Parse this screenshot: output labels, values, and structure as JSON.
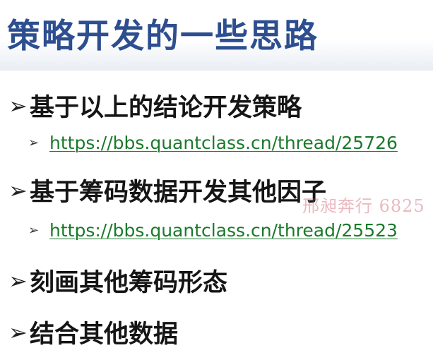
{
  "slide": {
    "title": "策略开发的一些思路",
    "bullets": [
      {
        "arrow": "➢",
        "text": "基于以上的结论开发策略",
        "link": {
          "arrow": "➢",
          "url": "https://bbs.quantclass.cn/thread/25726"
        }
      },
      {
        "arrow": "➢",
        "text": "基于筹码数据开发其他因子",
        "link": {
          "arrow": "➢",
          "url": "https://bbs.quantclass.cn/thread/25523"
        }
      },
      {
        "arrow": "➢",
        "text": "刻画其他筹码形态"
      },
      {
        "arrow": "➢",
        "text": "结合其他数据"
      }
    ],
    "watermark": "邢昶奔行 6825"
  },
  "colors": {
    "title": "#2d4e8f",
    "bullet_text": "#151515",
    "link": "#1a7a2a",
    "watermark": "#c8465a"
  }
}
